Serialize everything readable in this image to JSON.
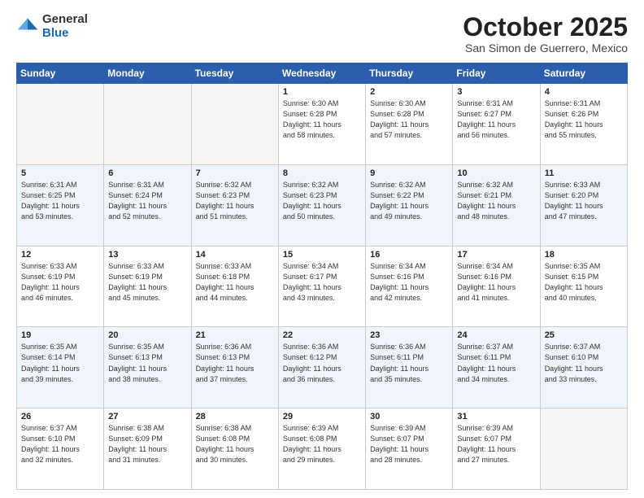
{
  "header": {
    "logo_general": "General",
    "logo_blue": "Blue",
    "month": "October 2025",
    "location": "San Simon de Guerrero, Mexico"
  },
  "days_of_week": [
    "Sunday",
    "Monday",
    "Tuesday",
    "Wednesday",
    "Thursday",
    "Friday",
    "Saturday"
  ],
  "weeks": [
    [
      {
        "num": "",
        "info": ""
      },
      {
        "num": "",
        "info": ""
      },
      {
        "num": "",
        "info": ""
      },
      {
        "num": "1",
        "info": "Sunrise: 6:30 AM\nSunset: 6:28 PM\nDaylight: 11 hours\nand 58 minutes."
      },
      {
        "num": "2",
        "info": "Sunrise: 6:30 AM\nSunset: 6:28 PM\nDaylight: 11 hours\nand 57 minutes."
      },
      {
        "num": "3",
        "info": "Sunrise: 6:31 AM\nSunset: 6:27 PM\nDaylight: 11 hours\nand 56 minutes."
      },
      {
        "num": "4",
        "info": "Sunrise: 6:31 AM\nSunset: 6:26 PM\nDaylight: 11 hours\nand 55 minutes."
      }
    ],
    [
      {
        "num": "5",
        "info": "Sunrise: 6:31 AM\nSunset: 6:25 PM\nDaylight: 11 hours\nand 53 minutes."
      },
      {
        "num": "6",
        "info": "Sunrise: 6:31 AM\nSunset: 6:24 PM\nDaylight: 11 hours\nand 52 minutes."
      },
      {
        "num": "7",
        "info": "Sunrise: 6:32 AM\nSunset: 6:23 PM\nDaylight: 11 hours\nand 51 minutes."
      },
      {
        "num": "8",
        "info": "Sunrise: 6:32 AM\nSunset: 6:23 PM\nDaylight: 11 hours\nand 50 minutes."
      },
      {
        "num": "9",
        "info": "Sunrise: 6:32 AM\nSunset: 6:22 PM\nDaylight: 11 hours\nand 49 minutes."
      },
      {
        "num": "10",
        "info": "Sunrise: 6:32 AM\nSunset: 6:21 PM\nDaylight: 11 hours\nand 48 minutes."
      },
      {
        "num": "11",
        "info": "Sunrise: 6:33 AM\nSunset: 6:20 PM\nDaylight: 11 hours\nand 47 minutes."
      }
    ],
    [
      {
        "num": "12",
        "info": "Sunrise: 6:33 AM\nSunset: 6:19 PM\nDaylight: 11 hours\nand 46 minutes."
      },
      {
        "num": "13",
        "info": "Sunrise: 6:33 AM\nSunset: 6:19 PM\nDaylight: 11 hours\nand 45 minutes."
      },
      {
        "num": "14",
        "info": "Sunrise: 6:33 AM\nSunset: 6:18 PM\nDaylight: 11 hours\nand 44 minutes."
      },
      {
        "num": "15",
        "info": "Sunrise: 6:34 AM\nSunset: 6:17 PM\nDaylight: 11 hours\nand 43 minutes."
      },
      {
        "num": "16",
        "info": "Sunrise: 6:34 AM\nSunset: 6:16 PM\nDaylight: 11 hours\nand 42 minutes."
      },
      {
        "num": "17",
        "info": "Sunrise: 6:34 AM\nSunset: 6:16 PM\nDaylight: 11 hours\nand 41 minutes."
      },
      {
        "num": "18",
        "info": "Sunrise: 6:35 AM\nSunset: 6:15 PM\nDaylight: 11 hours\nand 40 minutes."
      }
    ],
    [
      {
        "num": "19",
        "info": "Sunrise: 6:35 AM\nSunset: 6:14 PM\nDaylight: 11 hours\nand 39 minutes."
      },
      {
        "num": "20",
        "info": "Sunrise: 6:35 AM\nSunset: 6:13 PM\nDaylight: 11 hours\nand 38 minutes."
      },
      {
        "num": "21",
        "info": "Sunrise: 6:36 AM\nSunset: 6:13 PM\nDaylight: 11 hours\nand 37 minutes."
      },
      {
        "num": "22",
        "info": "Sunrise: 6:36 AM\nSunset: 6:12 PM\nDaylight: 11 hours\nand 36 minutes."
      },
      {
        "num": "23",
        "info": "Sunrise: 6:36 AM\nSunset: 6:11 PM\nDaylight: 11 hours\nand 35 minutes."
      },
      {
        "num": "24",
        "info": "Sunrise: 6:37 AM\nSunset: 6:11 PM\nDaylight: 11 hours\nand 34 minutes."
      },
      {
        "num": "25",
        "info": "Sunrise: 6:37 AM\nSunset: 6:10 PM\nDaylight: 11 hours\nand 33 minutes."
      }
    ],
    [
      {
        "num": "26",
        "info": "Sunrise: 6:37 AM\nSunset: 6:10 PM\nDaylight: 11 hours\nand 32 minutes."
      },
      {
        "num": "27",
        "info": "Sunrise: 6:38 AM\nSunset: 6:09 PM\nDaylight: 11 hours\nand 31 minutes."
      },
      {
        "num": "28",
        "info": "Sunrise: 6:38 AM\nSunset: 6:08 PM\nDaylight: 11 hours\nand 30 minutes."
      },
      {
        "num": "29",
        "info": "Sunrise: 6:39 AM\nSunset: 6:08 PM\nDaylight: 11 hours\nand 29 minutes."
      },
      {
        "num": "30",
        "info": "Sunrise: 6:39 AM\nSunset: 6:07 PM\nDaylight: 11 hours\nand 28 minutes."
      },
      {
        "num": "31",
        "info": "Sunrise: 6:39 AM\nSunset: 6:07 PM\nDaylight: 11 hours\nand 27 minutes."
      },
      {
        "num": "",
        "info": ""
      }
    ]
  ]
}
